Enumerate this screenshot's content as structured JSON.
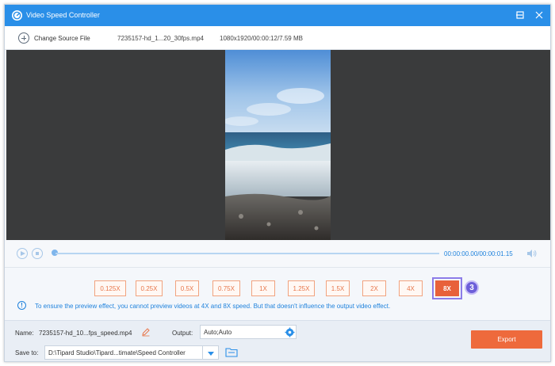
{
  "window": {
    "title": "Video Speed Controller",
    "accent_color": "#2a8fe8",
    "controls": [
      "minimize-icon",
      "maximize-icon",
      "close-icon"
    ]
  },
  "source": {
    "change_label": "Change Source File",
    "file_name": "7235157-hd_1...20_30fps.mp4",
    "file_meta": "1080x1920/00:00:12/7.59 MB"
  },
  "player": {
    "time": "00:00:00.00/00:00:01.15",
    "progress": 0
  },
  "speeds": {
    "options": [
      "0.125X",
      "0.25X",
      "0.5X",
      "0.75X",
      "1X",
      "1.25X",
      "1.5X",
      "2X",
      "4X",
      "8X"
    ],
    "selected": "8X",
    "step_badge": "3",
    "active_color": "#e8613a"
  },
  "info": {
    "icon": "info-icon",
    "text": "To ensure the preview effect, you cannot preview videos at 4X and 8X speed. But that doesn't influence the output video effect."
  },
  "output": {
    "name_label": "Name:",
    "name_value": "7235157-hd_10...fps_speed.mp4",
    "output_label": "Output:",
    "output_value": "Auto;Auto",
    "save_label": "Save to:",
    "save_path": "D:\\Tipard Studio\\Tipard...timate\\Speed Controller",
    "export_label": "Export"
  }
}
